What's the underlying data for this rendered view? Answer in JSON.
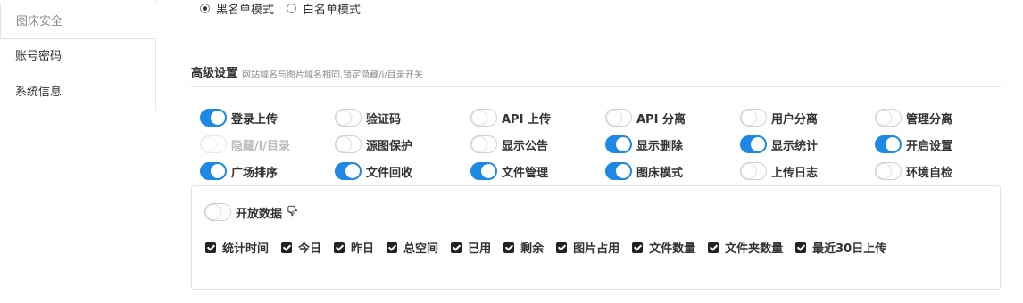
{
  "sidebar": {
    "items": [
      {
        "label": "图床安全",
        "active": true
      },
      {
        "label": "账号密码",
        "active": false
      },
      {
        "label": "系统信息",
        "active": false
      }
    ]
  },
  "mode_radio": {
    "options": [
      {
        "label": "黑名单模式",
        "selected": true
      },
      {
        "label": "白名单模式",
        "selected": false
      }
    ]
  },
  "advanced": {
    "title": "高级设置",
    "hint": "网站域名与图片域名相同,锁定隐藏/i/目录开关"
  },
  "toggles": [
    {
      "label": "登录上传",
      "on": true,
      "disabled": false
    },
    {
      "label": "验证码",
      "on": false,
      "disabled": false
    },
    {
      "label": "API 上传",
      "on": false,
      "disabled": false
    },
    {
      "label": "API 分离",
      "on": false,
      "disabled": false
    },
    {
      "label": "用户分离",
      "on": false,
      "disabled": false
    },
    {
      "label": "管理分离",
      "on": false,
      "disabled": false
    },
    {
      "label": "隐藏/i/目录",
      "on": false,
      "disabled": true
    },
    {
      "label": "源图保护",
      "on": false,
      "disabled": false
    },
    {
      "label": "显示公告",
      "on": false,
      "disabled": false
    },
    {
      "label": "显示删除",
      "on": true,
      "disabled": false
    },
    {
      "label": "显示统计",
      "on": true,
      "disabled": false
    },
    {
      "label": "开启设置",
      "on": true,
      "disabled": false
    },
    {
      "label": "广场排序",
      "on": true,
      "disabled": false
    },
    {
      "label": "文件回收",
      "on": true,
      "disabled": false
    },
    {
      "label": "文件管理",
      "on": true,
      "disabled": false
    },
    {
      "label": "图床模式",
      "on": true,
      "disabled": false
    },
    {
      "label": "上传日志",
      "on": false,
      "disabled": false
    },
    {
      "label": "环境自检",
      "on": false,
      "disabled": false
    }
  ],
  "open_data": {
    "label": "开放数据",
    "on": false,
    "icon": "hand-pointing-icon",
    "checkboxes": [
      {
        "label": "统计时间",
        "checked": true
      },
      {
        "label": "今日",
        "checked": true
      },
      {
        "label": "昨日",
        "checked": true
      },
      {
        "label": "总空间",
        "checked": true
      },
      {
        "label": "已用",
        "checked": true
      },
      {
        "label": "剩余",
        "checked": true
      },
      {
        "label": "图片占用",
        "checked": true
      },
      {
        "label": "文件数量",
        "checked": true
      },
      {
        "label": "文件夹数量",
        "checked": true
      },
      {
        "label": "最近30日上传",
        "checked": true
      }
    ]
  },
  "colors": {
    "accent": "#1e88e5",
    "border": "#e2e2e2",
    "hint_text": "#888888"
  }
}
